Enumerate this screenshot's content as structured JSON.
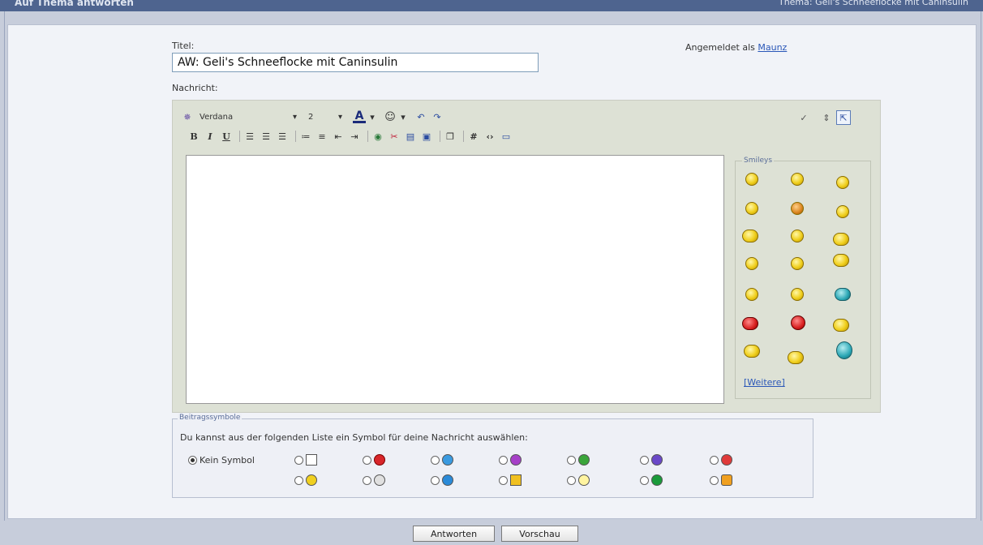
{
  "header": {
    "title": "Auf Thema antworten",
    "right_text": "Thema: Geli's Schneeflocke mit Caninsulin"
  },
  "form": {
    "title_label": "Titel:",
    "title_value": "AW: Geli's Schneeflocke mit Caninsulin",
    "message_label": "Nachricht:",
    "logged_in_prefix": "Angemeldet als",
    "username": "Maunz"
  },
  "toolbar": {
    "font": "Verdana",
    "size": "2",
    "font_color_letter": "A"
  },
  "smileys": {
    "legend": "Smileys",
    "more_link": "[Weitere]"
  },
  "post_icons": {
    "legend": "Beitragssymbole",
    "instruction": "Du kannst aus der folgenden Liste ein Symbol für deine Nachricht auswählen:",
    "none_label": "Kein Symbol"
  },
  "buttons": {
    "reply": "Antworten",
    "preview": "Vorschau"
  }
}
